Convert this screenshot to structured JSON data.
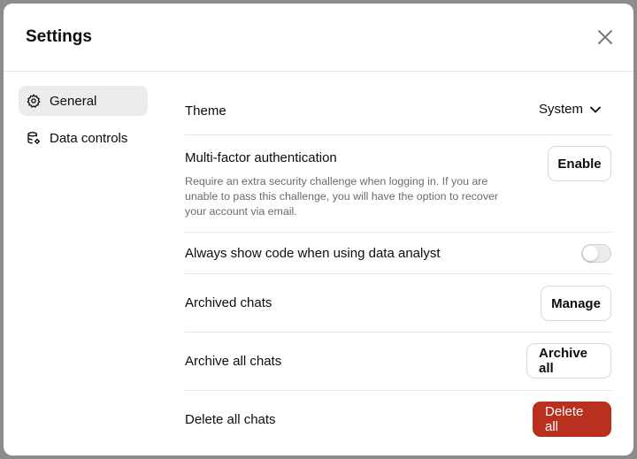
{
  "dialog": {
    "title": "Settings",
    "close_icon": "close-icon"
  },
  "sidebar": {
    "items": [
      {
        "label": "General",
        "icon": "gear-icon",
        "active": true
      },
      {
        "label": "Data controls",
        "icon": "database-settings-icon",
        "active": false
      }
    ]
  },
  "settings": {
    "theme": {
      "label": "Theme",
      "value": "System",
      "icon": "chevron-down-icon"
    },
    "mfa": {
      "label": "Multi-factor authentication",
      "description": "Require an extra security challenge when logging in. If you are unable to pass this challenge, you will have the option to recover your account via email.",
      "button": "Enable"
    },
    "code": {
      "label": "Always show code when using data analyst",
      "enabled": false
    },
    "archived": {
      "label": "Archived chats",
      "button": "Manage"
    },
    "archive_all": {
      "label": "Archive all chats",
      "button": "Archive all"
    },
    "delete_all": {
      "label": "Delete all chats",
      "button": "Delete all"
    }
  },
  "colors": {
    "danger": "#b9301f",
    "active_nav": "#ececec",
    "backdrop": "#8c8c8c"
  }
}
